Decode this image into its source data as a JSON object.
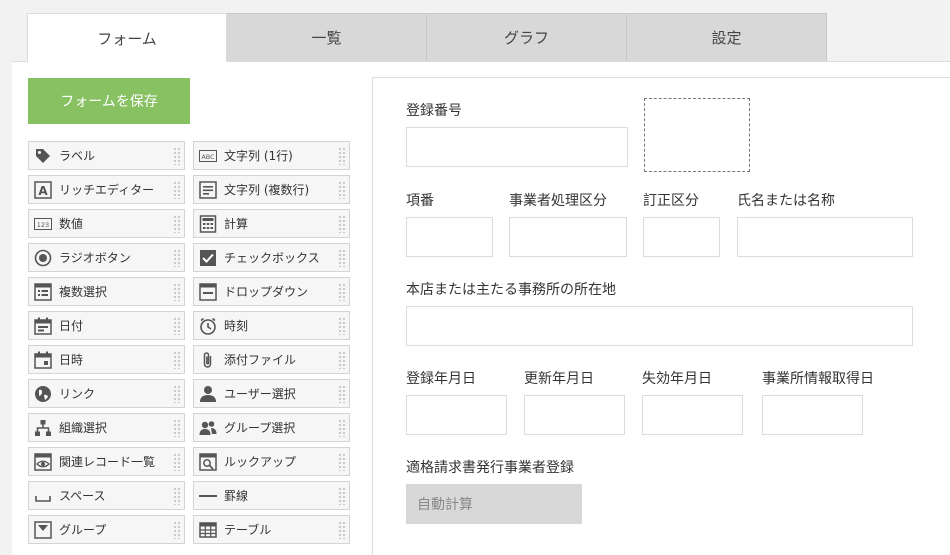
{
  "tabs": [
    {
      "label": "フォーム"
    },
    {
      "label": "一覧"
    },
    {
      "label": "グラフ"
    },
    {
      "label": "設定"
    }
  ],
  "save_button": "フォームを保存",
  "palette": [
    {
      "label": "ラベル",
      "icon": "tag-icon"
    },
    {
      "label": "文字列 (1行)",
      "icon": "abc-icon"
    },
    {
      "label": "リッチエディター",
      "icon": "rich-editor-icon"
    },
    {
      "label": "文字列 (複数行)",
      "icon": "multiline-text-icon"
    },
    {
      "label": "数値",
      "icon": "number-icon"
    },
    {
      "label": "計算",
      "icon": "calculator-icon"
    },
    {
      "label": "ラジオボタン",
      "icon": "radio-icon"
    },
    {
      "label": "チェックボックス",
      "icon": "checkbox-icon"
    },
    {
      "label": "複数選択",
      "icon": "multi-select-icon"
    },
    {
      "label": "ドロップダウン",
      "icon": "dropdown-icon"
    },
    {
      "label": "日付",
      "icon": "date-icon"
    },
    {
      "label": "時刻",
      "icon": "clock-icon"
    },
    {
      "label": "日時",
      "icon": "datetime-icon"
    },
    {
      "label": "添付ファイル",
      "icon": "paperclip-icon"
    },
    {
      "label": "リンク",
      "icon": "globe-icon"
    },
    {
      "label": "ユーザー選択",
      "icon": "user-icon"
    },
    {
      "label": "組織選択",
      "icon": "organization-icon"
    },
    {
      "label": "グループ選択",
      "icon": "group-users-icon"
    },
    {
      "label": "関連レコード一覧",
      "icon": "related-records-icon"
    },
    {
      "label": "ルックアップ",
      "icon": "lookup-icon"
    },
    {
      "label": "スペース",
      "icon": "space-icon"
    },
    {
      "label": "罫線",
      "icon": "line-icon"
    },
    {
      "label": "グループ",
      "icon": "group-icon"
    },
    {
      "label": "テーブル",
      "icon": "table-icon"
    }
  ],
  "form": {
    "registration_number": "登録番号",
    "item_number": "項番",
    "business_category": "事業者処理区分",
    "correction_category": "訂正区分",
    "name": "氏名または名称",
    "address": "本店または主たる事務所の所在地",
    "registration_date": "登録年月日",
    "update_date": "更新年月日",
    "expiry_date": "失効年月日",
    "acquisition_date": "事業所情報取得日",
    "invoice_registration": "適格請求書発行事業者登録",
    "auto_calc": "自動計算"
  },
  "colors": {
    "save_button_bg": "#88c161",
    "tab_inactive_bg": "#d8d8d8",
    "icon": "#555555"
  }
}
